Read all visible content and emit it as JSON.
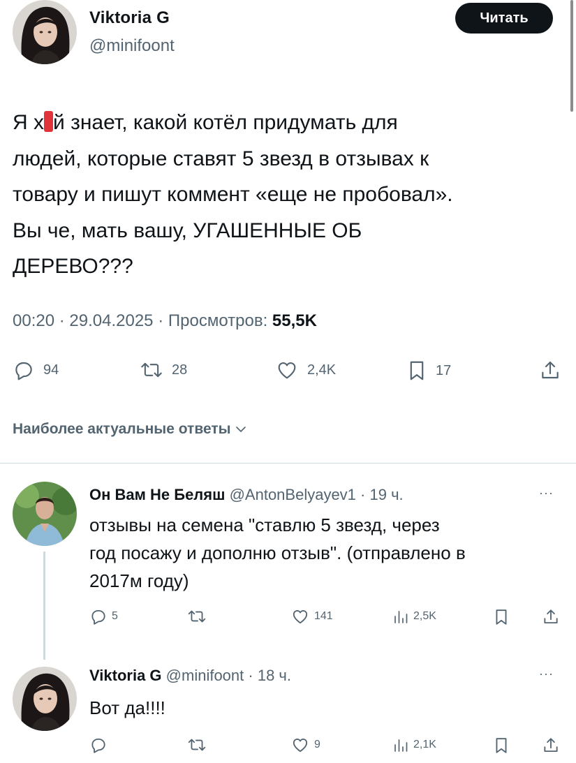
{
  "main_tweet": {
    "author_name": "Viktoria G",
    "author_handle": "@minifoont",
    "follow_label": "Читать",
    "text_lines": [
      {
        "pre": "Я х",
        "post": "й знает, какой котёл придумать для"
      },
      "людей, которые ставят 5 звезд в отзывах к",
      "товару и пишут коммент «еще не пробовал».",
      "Вы че, мать вашу, УГАШЕННЫЕ ОБ",
      "ДЕРЕВО???"
    ],
    "time": "00:20",
    "date": "29.04.2025",
    "views_label": "Просмотров:",
    "views_value": "55,5K",
    "sep": "·",
    "stats": {
      "replies": "94",
      "reposts": "28",
      "likes": "2,4K",
      "bookmarks": "17"
    }
  },
  "replies_section": {
    "label": "Наиболее актуальные ответы"
  },
  "replies": [
    {
      "author_name": "Он Вам Не Беляш",
      "author_handle": "@AntonBelyayev1",
      "time": "· 19 ч.",
      "text_lines": [
        "отзывы на семена \"ставлю 5 звезд, через",
        "год посажу и дополню отзыв\". (отправлено в",
        "2017м году)"
      ],
      "stats": {
        "replies": "5",
        "reposts": "",
        "likes": "141",
        "views": "2,5K"
      }
    },
    {
      "author_name": "Viktoria G",
      "author_handle": "@minifoont",
      "time": "· 18 ч.",
      "text_lines": [
        "Вот да!!!!"
      ],
      "stats": {
        "replies": "",
        "reposts": "",
        "likes": "9",
        "views": "2,1K"
      }
    }
  ],
  "colors": {
    "text": "#0f1419",
    "secondary": "#536471",
    "divider": "#cfd9de",
    "censor": "#e0343a"
  }
}
